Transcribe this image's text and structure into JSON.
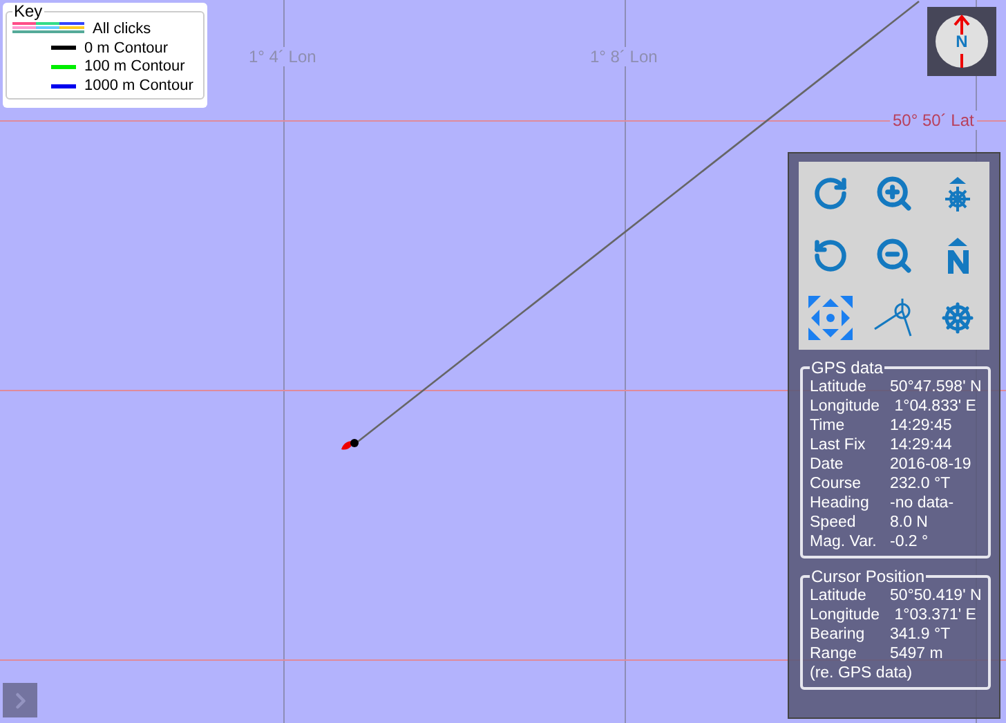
{
  "legend": {
    "title": "Key",
    "items": [
      {
        "kind": "clicks",
        "label": "All clicks"
      },
      {
        "kind": "line",
        "label": "0 m Contour",
        "color": "#000000"
      },
      {
        "kind": "line",
        "label": "100 m Contour",
        "color": "#00ee00"
      },
      {
        "kind": "line",
        "label": "1000 m Contour",
        "color": "#0000ee"
      }
    ]
  },
  "map": {
    "lon_labels": [
      "1° 4´ Lon",
      "1° 8´ Lon"
    ],
    "lat_labels": [
      "50° 50´ Lat"
    ]
  },
  "compass": {
    "letter": "N"
  },
  "gps": {
    "title": "GPS data",
    "rows": [
      {
        "label": "Latitude",
        "value": "50°47.598' N"
      },
      {
        "label": "Longitude",
        "value": " 1°04.833' E"
      },
      {
        "label": "Time",
        "value": "14:29:45"
      },
      {
        "label": "Last Fix",
        "value": "14:29:44"
      },
      {
        "label": "Date",
        "value": "2016-08-19"
      },
      {
        "label": "Course",
        "value": "232.0 °T"
      },
      {
        "label": "Heading",
        "value": "-no data-"
      },
      {
        "label": "Speed",
        "value": "8.0 N"
      },
      {
        "label": "Mag. Var.",
        "value": "-0.2 °"
      }
    ]
  },
  "cursor": {
    "title": "Cursor Position",
    "rows": [
      {
        "label": "Latitude",
        "value": "50°50.419' N"
      },
      {
        "label": "Longitude",
        "value": " 1°03.371' E"
      },
      {
        "label": "Bearing",
        "value": "341.9 °T"
      },
      {
        "label": "Range",
        "value": "5497 m"
      }
    ],
    "note": "(re. GPS data)"
  }
}
